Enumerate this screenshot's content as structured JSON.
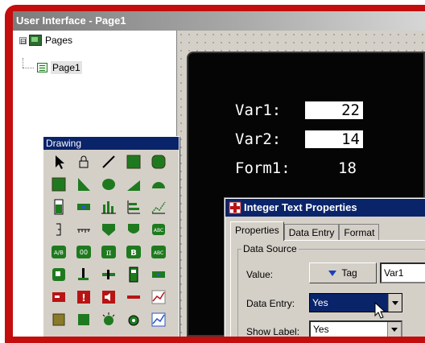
{
  "window": {
    "title": "User Interface - Page1"
  },
  "tree": {
    "root": {
      "label": "Pages",
      "expander": "⊟"
    },
    "child": {
      "label": "Page1"
    }
  },
  "screen": {
    "rows": [
      {
        "label": "Var1:",
        "value": "22"
      },
      {
        "label": "Var2:",
        "value": "14"
      },
      {
        "label": "Form1:",
        "value": "18"
      }
    ]
  },
  "drawing": {
    "title": "Drawing",
    "tools": [
      "pointer-icon",
      "lock-icon",
      "line-icon",
      "rectangle-icon",
      "rounded-rect-icon",
      "square-icon",
      "right-triangle-icon",
      "ellipse-icon",
      "triangle-icon",
      "semicircle-icon",
      "bar-gauge-icon",
      "slider-icon",
      "bar-chart-icon",
      "level-icon",
      "trend-icon",
      "scale-icon",
      "ruler-icon",
      "pentagon-icon",
      "shield-icon",
      "abc-text-icon",
      "ab-icon",
      "00-display-icon",
      "pi-icon",
      "b-icon",
      "abc-button-icon",
      "button-icon",
      "valve-icon",
      "pipe-icon",
      "tank-icon",
      "pump-icon",
      "alarm-icon",
      "exclamation-icon",
      "speaker-icon",
      "bar-icon",
      "graph-icon",
      "square-small-icon",
      "square-green-icon",
      "sun-icon",
      "gear-icon",
      "chart-icon"
    ],
    "glyphs": {
      "abc": "ABC",
      "ab": "A/B",
      "zeros": "00",
      "pi": "π",
      "bold_b": "B",
      "excl": "!"
    }
  },
  "dialog": {
    "title": "Integer Text Properties",
    "tabs": [
      "Properties",
      "Data Entry",
      "Format"
    ],
    "group": "Data Source",
    "value_label": "Value:",
    "tag_button": "Tag",
    "tag_value": "Var1",
    "data_entry_label": "Data Entry:",
    "data_entry_value": "Yes",
    "show_label_label": "Show Label:",
    "show_label_value": "Yes"
  },
  "colors": {
    "frame": "#c40d0d",
    "titlebar_active": "#0a246a",
    "screen_bg": "#050505",
    "tool_green": "#1f7a1f",
    "tool_red": "#b81414"
  }
}
